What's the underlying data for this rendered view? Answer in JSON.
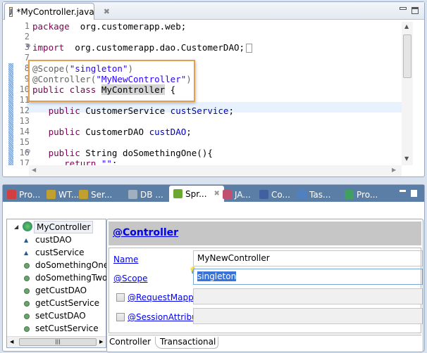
{
  "editor": {
    "tab_label": "*MyController.java",
    "lines": [
      {
        "n": "1",
        "code": [
          [
            "kw",
            "package"
          ],
          [
            "",
            "  org.customerapp.web;"
          ]
        ]
      },
      {
        "n": "2",
        "code": []
      },
      {
        "n": "3",
        "code": [
          [
            "kw",
            "import"
          ],
          [
            "",
            "  org.customerapp.dao.CustomerDAO;"
          ]
        ]
      },
      {
        "n": "7",
        "code": []
      },
      {
        "n": "8",
        "code": [
          [
            "ann",
            "@Scope("
          ],
          [
            "str",
            "\"singleton\""
          ],
          [
            "ann",
            ")"
          ]
        ]
      },
      {
        "n": "9",
        "code": [
          [
            "ann",
            "@Controller("
          ],
          [
            "str",
            "\"MyNewController\""
          ],
          [
            "ann",
            ")"
          ]
        ]
      },
      {
        "n": "10",
        "code": [
          [
            "kw",
            "public class "
          ],
          [
            "sel",
            "MyController"
          ],
          [
            "",
            " {"
          ]
        ]
      },
      {
        "n": "11",
        "code": []
      },
      {
        "n": "12",
        "code": [
          [
            "",
            "   "
          ],
          [
            "kw",
            "public"
          ],
          [
            "",
            " CustomerService "
          ],
          [
            "fld",
            "custService"
          ],
          [
            "",
            ";"
          ]
        ]
      },
      {
        "n": "13",
        "code": []
      },
      {
        "n": "14",
        "code": [
          [
            "",
            "   "
          ],
          [
            "kw",
            "public"
          ],
          [
            "",
            " CustomerDAO "
          ],
          [
            "fld",
            "custDAO"
          ],
          [
            "",
            ";"
          ]
        ]
      },
      {
        "n": "15",
        "code": []
      },
      {
        "n": "16",
        "code": [
          [
            "",
            "   "
          ],
          [
            "kw",
            "public"
          ],
          [
            "",
            " String doSomethingOne(){"
          ]
        ]
      },
      {
        "n": "17",
        "code": [
          [
            "",
            "      "
          ],
          [
            "kw",
            "return"
          ],
          [
            "str",
            " \"\""
          ],
          [
            "",
            ";"
          ]
        ]
      }
    ]
  },
  "bottom": {
    "tabs": [
      {
        "label": "Pro...",
        "icon": "problems-icon",
        "color": "#d04040"
      },
      {
        "label": "WT...",
        "icon": "servers-icon",
        "color": "#c0a030"
      },
      {
        "label": "Ser...",
        "icon": "servers-icon",
        "color": "#c0a030"
      },
      {
        "label": "DB ...",
        "icon": "database-icon",
        "color": "#a0b0c0"
      },
      {
        "label": "Spr...",
        "icon": "spring-leaf-icon",
        "color": "#6aa830",
        "active": true
      },
      {
        "label": "JA...",
        "icon": "jaxws-icon",
        "color": "#c05070"
      },
      {
        "label": "Co...",
        "icon": "console-icon",
        "color": "#4060a0"
      },
      {
        "label": "Tas...",
        "icon": "tasks-icon",
        "color": "#5080c0"
      },
      {
        "label": "Pro...",
        "icon": "progress-icon",
        "color": "#40a060"
      }
    ],
    "tree": {
      "root": "MyController",
      "fields": [
        "custDAO",
        "custService"
      ],
      "methods": [
        "doSomethingOne",
        "doSomethingTwo",
        "getCustDAO",
        "getCustService",
        "setCustDAO",
        "setCustService"
      ]
    },
    "details": {
      "header": "@Controller",
      "name_label": "Name",
      "name_value": "MyNewController",
      "scope_label": "@Scope",
      "scope_value": "singleton",
      "request_mapping_label": "@RequestMapping",
      "session_attributes_label": "@SessionAttributes",
      "subtabs": [
        "Controller",
        "Transactional"
      ]
    }
  }
}
